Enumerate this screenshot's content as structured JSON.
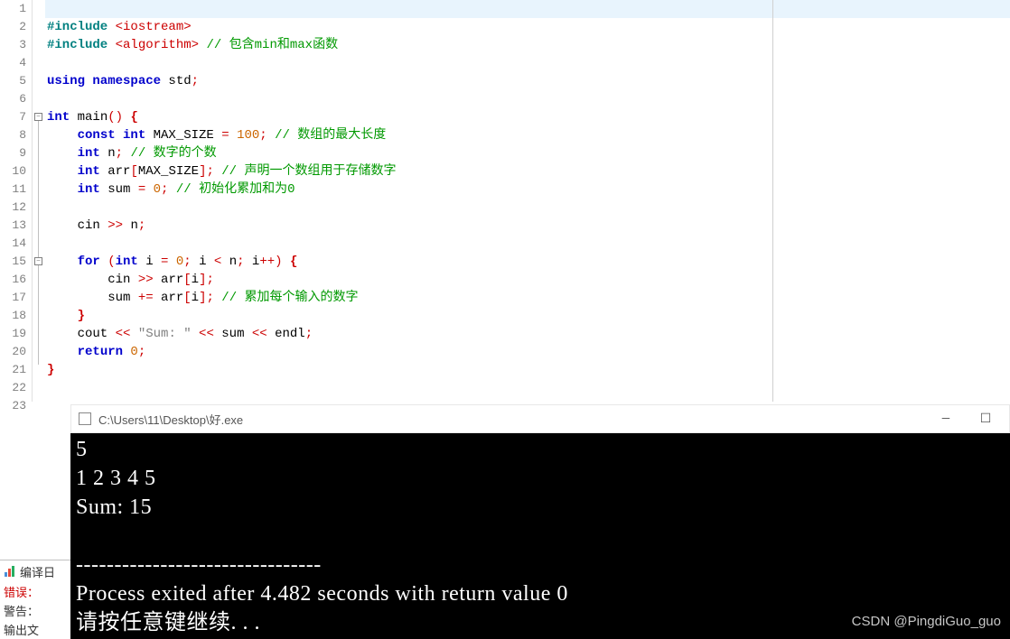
{
  "editor": {
    "highlighted_line": 1,
    "lines": [
      {
        "n": 1,
        "tokens": []
      },
      {
        "n": 2,
        "tokens": [
          {
            "t": "#include ",
            "c": "pp"
          },
          {
            "t": "<iostream>",
            "c": "op"
          }
        ]
      },
      {
        "n": 3,
        "tokens": [
          {
            "t": "#include ",
            "c": "pp"
          },
          {
            "t": "<algorithm>",
            "c": "op"
          },
          {
            "t": " ",
            "c": "id"
          },
          {
            "t": "// 包含min和max函数",
            "c": "com"
          }
        ]
      },
      {
        "n": 4,
        "tokens": []
      },
      {
        "n": 5,
        "tokens": [
          {
            "t": "using namespace ",
            "c": "kw"
          },
          {
            "t": "std",
            "c": "id"
          },
          {
            "t": ";",
            "c": "op"
          }
        ]
      },
      {
        "n": 6,
        "tokens": []
      },
      {
        "n": 7,
        "tokens": [
          {
            "t": "int ",
            "c": "kw2"
          },
          {
            "t": "main",
            "c": "id"
          },
          {
            "t": "()",
            "c": "op"
          },
          {
            "t": " ",
            "c": "id"
          },
          {
            "t": "{",
            "c": "br"
          }
        ]
      },
      {
        "n": 8,
        "tokens": [
          {
            "t": "    ",
            "c": "id"
          },
          {
            "t": "const int ",
            "c": "kw2"
          },
          {
            "t": "MAX_SIZE ",
            "c": "id"
          },
          {
            "t": "= ",
            "c": "op"
          },
          {
            "t": "100",
            "c": "num"
          },
          {
            "t": ";",
            "c": "op"
          },
          {
            "t": " ",
            "c": "id"
          },
          {
            "t": "// 数组的最大长度",
            "c": "com"
          }
        ]
      },
      {
        "n": 9,
        "tokens": [
          {
            "t": "    ",
            "c": "id"
          },
          {
            "t": "int ",
            "c": "kw2"
          },
          {
            "t": "n",
            "c": "id"
          },
          {
            "t": ";",
            "c": "op"
          },
          {
            "t": " ",
            "c": "id"
          },
          {
            "t": "// 数字的个数",
            "c": "com"
          }
        ]
      },
      {
        "n": 10,
        "tokens": [
          {
            "t": "    ",
            "c": "id"
          },
          {
            "t": "int ",
            "c": "kw2"
          },
          {
            "t": "arr",
            "c": "id"
          },
          {
            "t": "[",
            "c": "op"
          },
          {
            "t": "MAX_SIZE",
            "c": "id"
          },
          {
            "t": "];",
            "c": "op"
          },
          {
            "t": " ",
            "c": "id"
          },
          {
            "t": "// 声明一个数组用于存储数字",
            "c": "com"
          }
        ]
      },
      {
        "n": 11,
        "tokens": [
          {
            "t": "    ",
            "c": "id"
          },
          {
            "t": "int ",
            "c": "kw2"
          },
          {
            "t": "sum ",
            "c": "id"
          },
          {
            "t": "= ",
            "c": "op"
          },
          {
            "t": "0",
            "c": "num"
          },
          {
            "t": ";",
            "c": "op"
          },
          {
            "t": " ",
            "c": "id"
          },
          {
            "t": "// 初始化累加和为0",
            "c": "com"
          }
        ]
      },
      {
        "n": 12,
        "tokens": []
      },
      {
        "n": 13,
        "tokens": [
          {
            "t": "    cin ",
            "c": "id"
          },
          {
            "t": ">> ",
            "c": "op"
          },
          {
            "t": "n",
            "c": "id"
          },
          {
            "t": ";",
            "c": "op"
          }
        ]
      },
      {
        "n": 14,
        "tokens": []
      },
      {
        "n": 15,
        "tokens": [
          {
            "t": "    ",
            "c": "id"
          },
          {
            "t": "for ",
            "c": "kw"
          },
          {
            "t": "(",
            "c": "op"
          },
          {
            "t": "int ",
            "c": "kw2"
          },
          {
            "t": "i ",
            "c": "id"
          },
          {
            "t": "= ",
            "c": "op"
          },
          {
            "t": "0",
            "c": "num"
          },
          {
            "t": "; ",
            "c": "op"
          },
          {
            "t": "i ",
            "c": "id"
          },
          {
            "t": "< ",
            "c": "op"
          },
          {
            "t": "n",
            "c": "id"
          },
          {
            "t": "; ",
            "c": "op"
          },
          {
            "t": "i",
            "c": "id"
          },
          {
            "t": "++) ",
            "c": "op"
          },
          {
            "t": "{",
            "c": "br"
          }
        ]
      },
      {
        "n": 16,
        "tokens": [
          {
            "t": "        cin ",
            "c": "id"
          },
          {
            "t": ">> ",
            "c": "op"
          },
          {
            "t": "arr",
            "c": "id"
          },
          {
            "t": "[",
            "c": "op"
          },
          {
            "t": "i",
            "c": "id"
          },
          {
            "t": "];",
            "c": "op"
          }
        ]
      },
      {
        "n": 17,
        "tokens": [
          {
            "t": "        sum ",
            "c": "id"
          },
          {
            "t": "+= ",
            "c": "op"
          },
          {
            "t": "arr",
            "c": "id"
          },
          {
            "t": "[",
            "c": "op"
          },
          {
            "t": "i",
            "c": "id"
          },
          {
            "t": "];",
            "c": "op"
          },
          {
            "t": " ",
            "c": "id"
          },
          {
            "t": "// 累加每个输入的数字",
            "c": "com"
          }
        ]
      },
      {
        "n": 18,
        "tokens": [
          {
            "t": "    ",
            "c": "id"
          },
          {
            "t": "}",
            "c": "br"
          }
        ]
      },
      {
        "n": 19,
        "tokens": [
          {
            "t": "    cout ",
            "c": "id"
          },
          {
            "t": "<< ",
            "c": "op"
          },
          {
            "t": "\"Sum: \"",
            "c": "str"
          },
          {
            "t": " << ",
            "c": "op"
          },
          {
            "t": "sum ",
            "c": "id"
          },
          {
            "t": "<< ",
            "c": "op"
          },
          {
            "t": "endl",
            "c": "id"
          },
          {
            "t": ";",
            "c": "op"
          }
        ]
      },
      {
        "n": 20,
        "tokens": [
          {
            "t": "    ",
            "c": "id"
          },
          {
            "t": "return ",
            "c": "kw"
          },
          {
            "t": "0",
            "c": "num"
          },
          {
            "t": ";",
            "c": "op"
          }
        ]
      },
      {
        "n": 21,
        "tokens": [
          {
            "t": "}",
            "c": "br"
          }
        ]
      },
      {
        "n": 22,
        "tokens": []
      },
      {
        "n": 23,
        "tokens": []
      }
    ],
    "fold_markers": [
      {
        "line": 7
      },
      {
        "line": 15
      }
    ]
  },
  "console": {
    "title": "C:\\Users\\11\\Desktop\\好.exe",
    "output": "5\n1 2 3 4 5\nSum: 15\n\n--------------------------------\nProcess exited after 4.482 seconds with return value 0\n请按任意键继续. . ."
  },
  "bottom": {
    "tab_label": "编译日",
    "error_label": "错误：",
    "warn_label": "警告：",
    "out_label": "输出文"
  },
  "watermark": "CSDN @PingdiGuo_guo"
}
